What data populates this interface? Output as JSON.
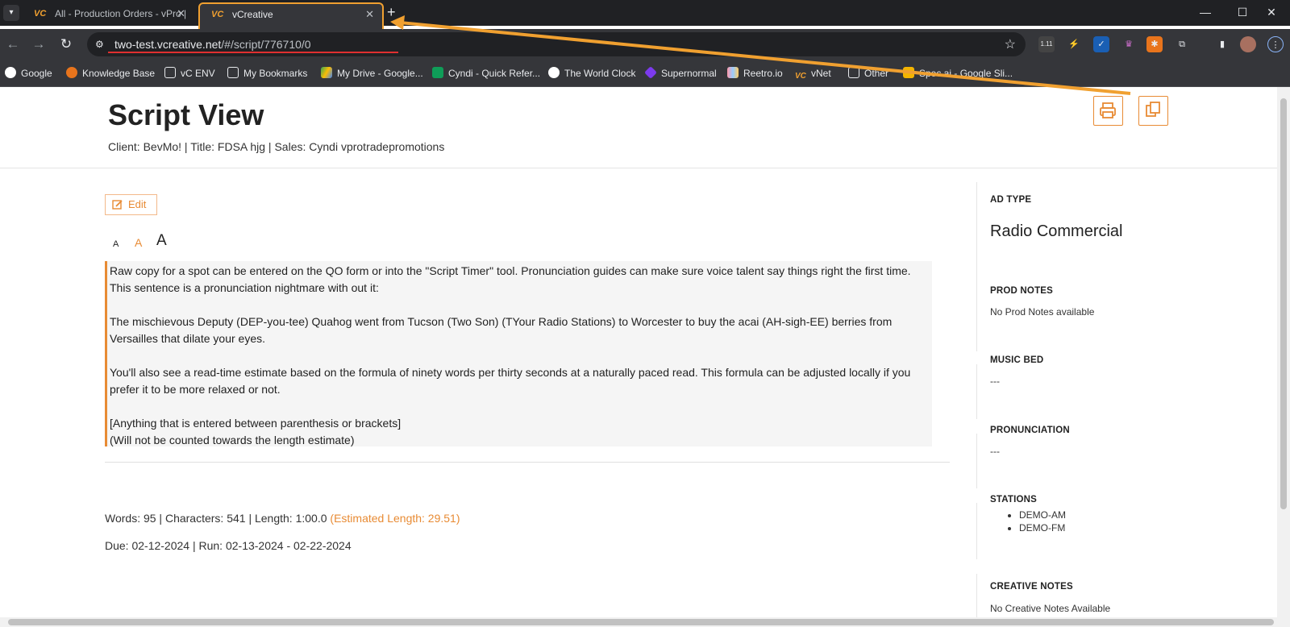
{
  "browser": {
    "tabs": [
      {
        "title": "All - Production Orders - vPro |",
        "favicon": "vc-logo-icon",
        "active": false
      },
      {
        "title": "vCreative",
        "favicon": "vc-logo-icon",
        "active": true
      }
    ],
    "url_host": "two-test.vcreative.net",
    "url_path": "/#/script/776710/0",
    "extension_badge": "1.11",
    "bookmarks": [
      "Google",
      "Knowledge Base",
      "vC ENV",
      "My Bookmarks",
      "My Drive - Google...",
      "Cyndi - Quick Refer...",
      "The World Clock",
      "Supernormal",
      "Reetro.io",
      "vNet",
      "Other",
      "Spec.ai - Google Sli..."
    ]
  },
  "page": {
    "title": "Script View",
    "meta": "Client: BevMo! | Title: FDSA hjg | Sales: Cyndi vprotradepromotions",
    "edit_label": "Edit",
    "font_sizes": [
      "A",
      "A",
      "A"
    ],
    "script_paragraphs": [
      "Raw copy for a spot can be entered on the QO form or into the \"Script Timer\" tool. Pronunciation guides can make sure voice talent say things right the first time. This sentence is a pronunciation nightmare with out it:",
      "The mischievous Deputy (DEP-you-tee) Quahog went from Tucson (Two Son) (TYour Radio Stations) to Worcester to buy the acai (AH-sigh-EE) berries from Versailles that dilate your eyes.",
      "You'll also see a read-time estimate based on the formula of ninety words per thirty seconds at a naturally paced read. This formula can be adjusted locally if you prefer it to be more relaxed or not.",
      "[Anything that is entered between parenthesis or brackets]",
      "(Will not be counted towards the length estimate)"
    ],
    "stats": "Words: 95 | Characters: 541 | Length: 1:00.0 ",
    "estimated": "(Estimated Length: 29.51)",
    "dates": "Due: 02-12-2024 | Run: 02-13-2024 - 02-22-2024"
  },
  "sidebar": {
    "ad_type_label": "AD TYPE",
    "ad_type_value": "Radio Commercial",
    "prod_notes_label": "PROD NOTES",
    "prod_notes_value": "No Prod Notes available",
    "music_bed_label": "MUSIC BED",
    "music_bed_value": "---",
    "pronunciation_label": "PRONUNCIATION",
    "pronunciation_value": "---",
    "stations_label": "STATIONS",
    "stations": [
      "DEMO-AM",
      "DEMO-FM"
    ],
    "creative_notes_label": "CREATIVE NOTES",
    "creative_notes_value": "No Creative Notes Available"
  },
  "colors": {
    "accent": "#e88b34",
    "annotation": "#f0a030"
  }
}
